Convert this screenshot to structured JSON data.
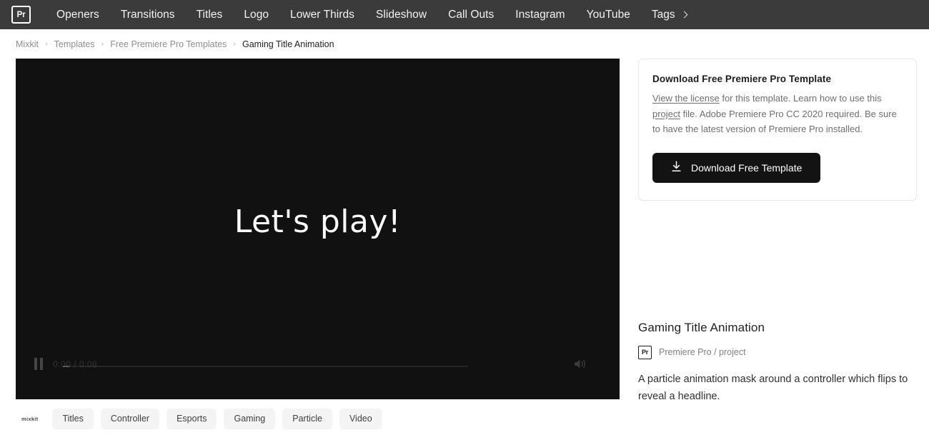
{
  "navbar": {
    "logo_text": "Pr",
    "items": [
      {
        "label": "Openers"
      },
      {
        "label": "Transitions"
      },
      {
        "label": "Titles"
      },
      {
        "label": "Logo"
      },
      {
        "label": "Lower Thirds"
      },
      {
        "label": "Slideshow"
      },
      {
        "label": "Call Outs"
      },
      {
        "label": "Instagram"
      },
      {
        "label": "YouTube"
      }
    ],
    "tags_label": "Tags",
    "background_color": "#3b3b3b"
  },
  "breadcrumb": {
    "separator": "›",
    "items": [
      {
        "label": "Mixkit",
        "current": false
      },
      {
        "label": "Templates",
        "current": false
      },
      {
        "label": "Free Premiere Pro Templates",
        "current": false
      },
      {
        "label": "Gaming Title Animation",
        "current": true
      }
    ]
  },
  "player": {
    "overlay_title": "Let's play!",
    "time_display": "0:00 / 0:08",
    "background_color": "#111111",
    "progress_percent": 1.5
  },
  "tags": {
    "brand_mark": "mixkit",
    "items": [
      {
        "label": "Titles"
      },
      {
        "label": "Controller"
      },
      {
        "label": "Esports"
      },
      {
        "label": "Gaming"
      },
      {
        "label": "Particle"
      },
      {
        "label": "Video"
      }
    ]
  },
  "download_card": {
    "title": "Download Free Premiere Pro Template",
    "link_license": "View the license",
    "text_part1": " for this template. Learn how to use this ",
    "link_project": "project",
    "text_part2": " file. Adobe Premiere Pro CC 2020 required. Be sure to have the latest version of Premiere Pro installed.",
    "button_label": "Download Free Template",
    "button_color": "#131313"
  },
  "meta": {
    "title": "Gaming Title Animation",
    "badge_text": "Pr",
    "type_text": "Premiere Pro / project",
    "description": "A particle animation mask around a controller which flips to reveal a headline."
  }
}
